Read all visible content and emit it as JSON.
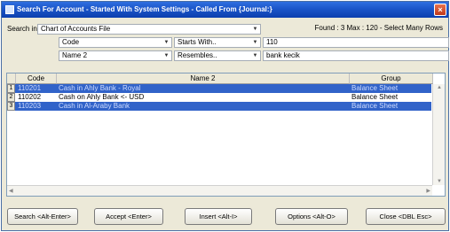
{
  "window": {
    "title": "Search For Account - Started With System Settings - Called From {Journal:}",
    "close_glyph": "×"
  },
  "search": {
    "search_in_label": "Search in",
    "search_in_value": "Chart of Accounts File",
    "found_text": "Found : 3 Max : 120 - Select Many Rows",
    "filter1": {
      "field": "Code",
      "operator": "Starts With..",
      "value": "110"
    },
    "filter2": {
      "field": "Name 2",
      "operator": "Resembles..",
      "value": "bank kecik"
    }
  },
  "grid": {
    "columns": [
      "Code",
      "Name 2",
      "Group"
    ],
    "rows": [
      {
        "num": "1",
        "code": "110201",
        "name": "Cash in Ahly Bank - Royal",
        "group": "Balance Sheet",
        "selected": true
      },
      {
        "num": "2",
        "code": "110202",
        "name": "Cash on Ahly Bank <- USD",
        "group": "Balance Sheet",
        "selected": false
      },
      {
        "num": "3",
        "code": "110203",
        "name": "Cash in Al-Araby Bank",
        "group": "Balance Sheet",
        "selected": true
      }
    ]
  },
  "buttons": {
    "search": "Search <Alt-Enter>",
    "accept": "Accept <Enter>",
    "insert": "Insert <Alt-I>",
    "options": "Options <Alt-O>",
    "close": "Close <DBL Esc>"
  },
  "colors": {
    "title_bar": "#1b55c9",
    "selection": "#3163c9",
    "dialog_bg": "#ece9d8"
  }
}
